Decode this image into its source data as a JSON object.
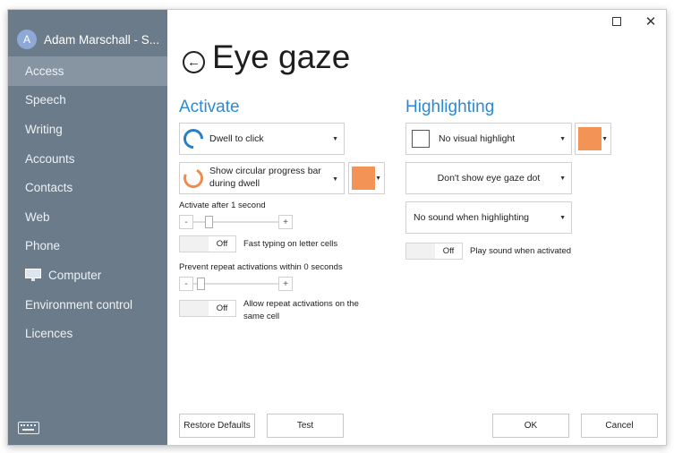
{
  "user": {
    "initial": "A",
    "name": "Adam Marschall - S..."
  },
  "nav": [
    {
      "label": "Access",
      "active": true
    },
    {
      "label": "Speech"
    },
    {
      "label": "Writing"
    },
    {
      "label": "Accounts"
    },
    {
      "label": "Contacts"
    },
    {
      "label": "Web"
    },
    {
      "label": "Phone"
    },
    {
      "label": "Computer",
      "icon": "computer-icon"
    },
    {
      "label": "Environment control"
    },
    {
      "label": "Licences"
    }
  ],
  "header": {
    "title": "Eye gaze"
  },
  "activate": {
    "heading": "Activate",
    "dwell_mode": "Dwell to click",
    "progress_style": "Show circular progress bar during dwell",
    "progress_color": "#F39356",
    "activate_after_label": "Activate after 1 second",
    "activate_after_seconds": 1,
    "fast_typing": {
      "state": "Off",
      "label": "Fast typing on letter cells"
    },
    "prevent_repeat_label": "Prevent repeat activations within 0 seconds",
    "prevent_repeat_seconds": 0,
    "allow_repeat": {
      "state": "Off",
      "label": "Allow repeat activations on the same cell"
    }
  },
  "highlighting": {
    "heading": "Highlighting",
    "visual_highlight": "No visual highlight",
    "highlight_color": "#F39356",
    "eye_gaze_dot": "Don't show eye gaze dot",
    "sound": "No sound when highlighting",
    "play_sound": {
      "state": "Off",
      "label": "Play sound when activated"
    }
  },
  "footer": {
    "restore_defaults": "Restore Defaults",
    "test": "Test",
    "ok": "OK",
    "cancel": "Cancel"
  },
  "window": {
    "maximize_icon": "maximize-icon",
    "close_icon": "close-icon",
    "close_glyph": "✕"
  }
}
